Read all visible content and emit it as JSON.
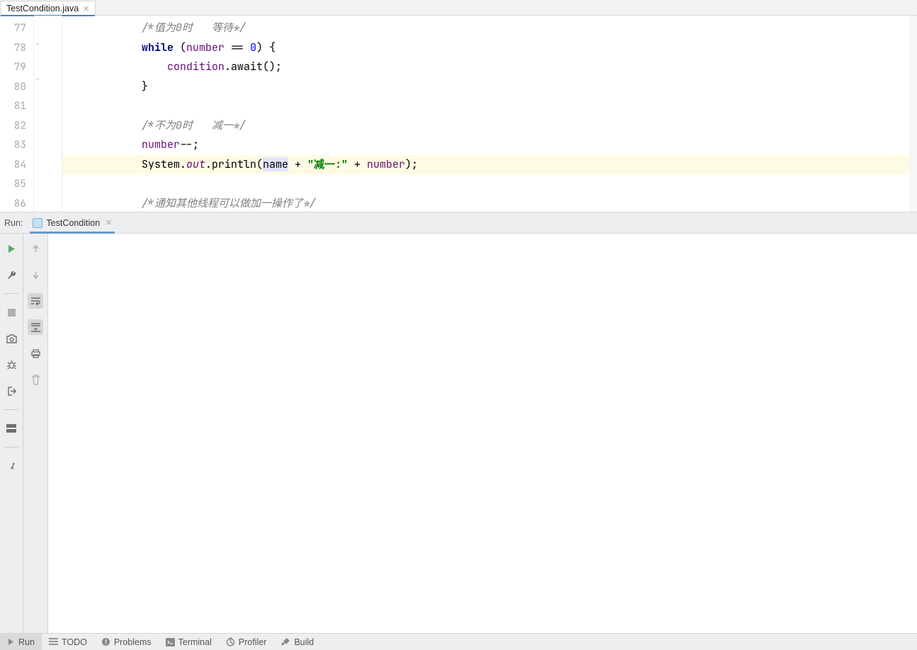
{
  "file_tab": {
    "label": "TestCondition.java"
  },
  "gutter": {
    "start": 77,
    "end": 86
  },
  "code": {
    "lines": [
      {
        "n": 77,
        "tokens": [
          {
            "t": "ind",
            "v": "            "
          },
          {
            "t": "cm",
            "v": "/*值为0时   等待*/"
          }
        ]
      },
      {
        "n": 78,
        "tokens": [
          {
            "t": "ind",
            "v": "            "
          },
          {
            "t": "kw",
            "v": "while"
          },
          {
            "t": "pl",
            "v": " ("
          },
          {
            "t": "fd",
            "v": "number"
          },
          {
            "t": "pl",
            "v": " == "
          },
          {
            "t": "nm",
            "v": "0"
          },
          {
            "t": "pl",
            "v": ") {"
          }
        ]
      },
      {
        "n": 79,
        "tokens": [
          {
            "t": "ind",
            "v": "                "
          },
          {
            "t": "fd",
            "v": "condition"
          },
          {
            "t": "pl",
            "v": ".await();"
          }
        ]
      },
      {
        "n": 80,
        "tokens": [
          {
            "t": "ind",
            "v": "            "
          },
          {
            "t": "pl",
            "v": "}"
          }
        ]
      },
      {
        "n": 81,
        "tokens": []
      },
      {
        "n": 82,
        "tokens": [
          {
            "t": "ind",
            "v": "            "
          },
          {
            "t": "cm",
            "v": "/*不为0时   减一*/"
          }
        ]
      },
      {
        "n": 83,
        "tokens": [
          {
            "t": "ind",
            "v": "            "
          },
          {
            "t": "fd",
            "v": "number"
          },
          {
            "t": "pl",
            "v": "--;"
          }
        ]
      },
      {
        "n": 84,
        "hl": true,
        "tokens": [
          {
            "t": "ind",
            "v": "            "
          },
          {
            "t": "pl",
            "v": "System."
          },
          {
            "t": "it",
            "v": "out"
          },
          {
            "t": "pl",
            "v": ".println("
          },
          {
            "t": "sel",
            "v": "name"
          },
          {
            "t": "pl",
            "v": " + "
          },
          {
            "t": "st",
            "v": "\"减一:\""
          },
          {
            "t": "pl",
            "v": " + "
          },
          {
            "t": "fd",
            "v": "number"
          },
          {
            "t": "pl",
            "v": ");"
          }
        ]
      },
      {
        "n": 85,
        "tokens": []
      },
      {
        "n": 86,
        "tokens": [
          {
            "t": "ind",
            "v": "            "
          },
          {
            "t": "cm",
            "v": "/*通知其他线程可以做加一操作了*/"
          }
        ]
      }
    ]
  },
  "run_panel": {
    "label": "Run:",
    "config_name": "TestCondition"
  },
  "bottom_bar": {
    "items": [
      {
        "key": "run",
        "label": "Run",
        "active": true
      },
      {
        "key": "todo",
        "label": "TODO"
      },
      {
        "key": "problems",
        "label": "Problems"
      },
      {
        "key": "terminal",
        "label": "Terminal"
      },
      {
        "key": "profiler",
        "label": "Profiler"
      },
      {
        "key": "build",
        "label": "Build"
      }
    ]
  }
}
